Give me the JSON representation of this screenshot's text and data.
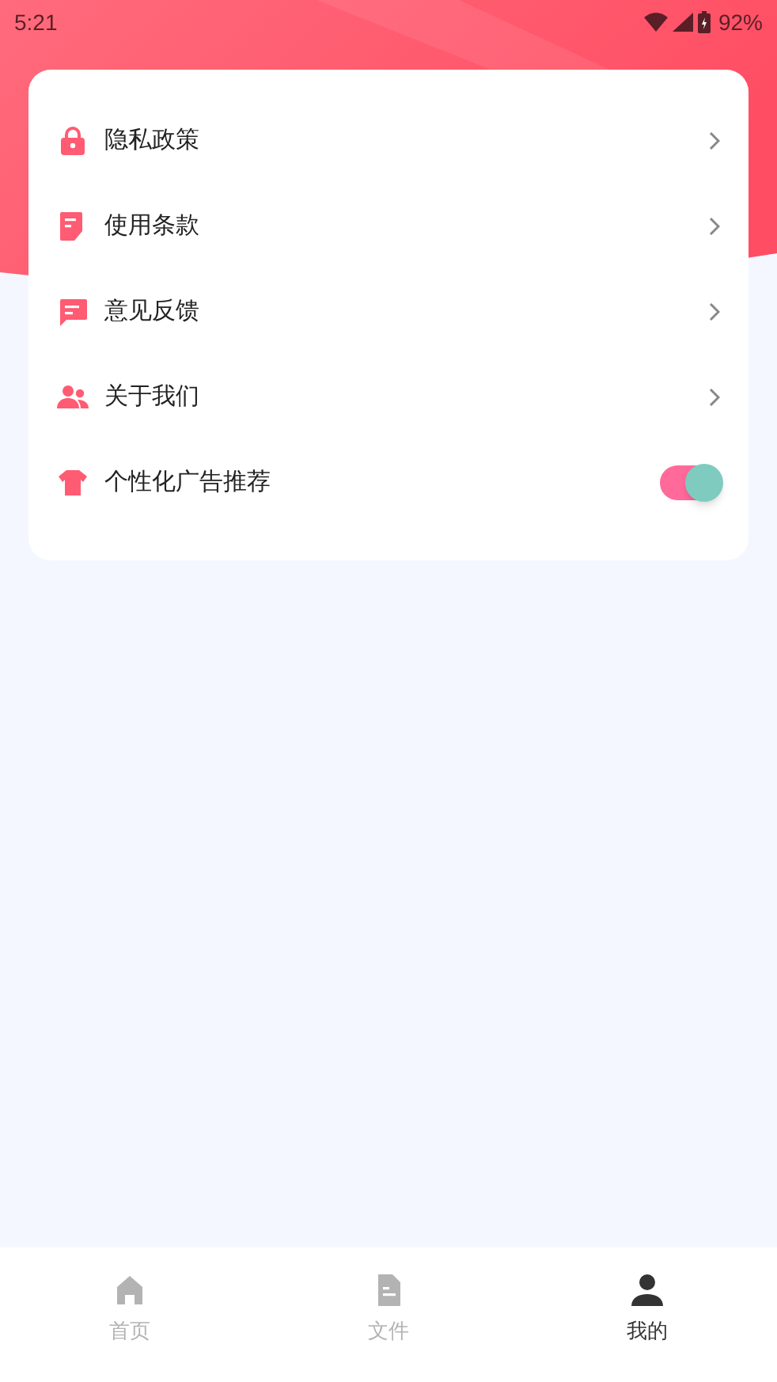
{
  "status_bar": {
    "time": "5:21",
    "battery": "92%"
  },
  "menu": [
    {
      "kind": "link",
      "label": "隐私政策"
    },
    {
      "kind": "link",
      "label": "使用条款"
    },
    {
      "kind": "link",
      "label": "意见反馈"
    },
    {
      "kind": "link",
      "label": "关于我们"
    },
    {
      "kind": "toggle",
      "label": "个性化广告推荐",
      "on": true
    }
  ],
  "tabs": [
    {
      "label": "首页",
      "selected": false
    },
    {
      "label": "文件",
      "selected": false
    },
    {
      "label": "我的",
      "selected": true
    }
  ]
}
